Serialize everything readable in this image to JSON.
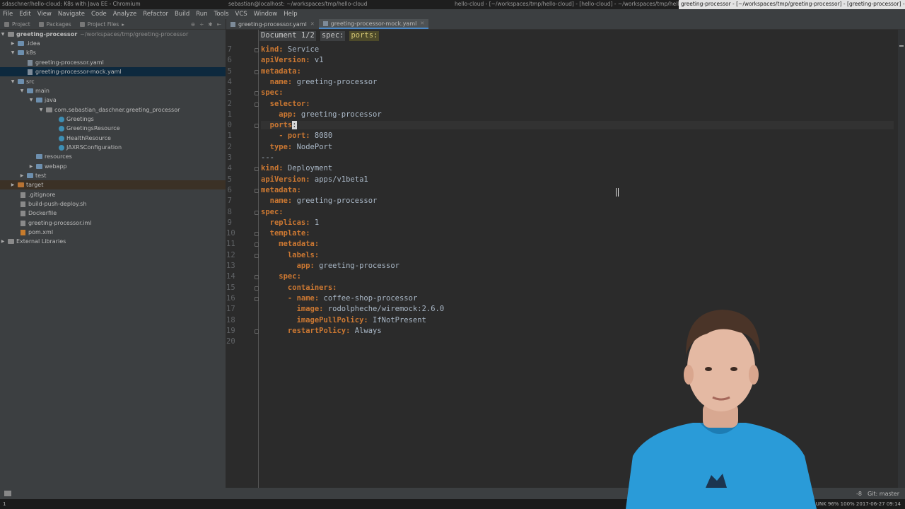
{
  "os_titles": [
    "sdaschner/hello-cloud: K8s with Java EE - Chromium",
    "sebastian@localhost: ~/workspaces/tmp/hello-cloud",
    "hello-cloud - [~/workspaces/tmp/hello-cloud] - [hello-cloud] - ~/workspaces/tmp/hello-cloud/...",
    "greeting-processor - [~/workspaces/tmp/greeting-processor] - [greeting-processor] - ~/worksp..."
  ],
  "menu": [
    "File",
    "Edit",
    "View",
    "Navigate",
    "Code",
    "Analyze",
    "Refactor",
    "Build",
    "Run",
    "Tools",
    "VCS",
    "Window",
    "Help"
  ],
  "project_toolbar": {
    "tabs": [
      "Project",
      "Packages",
      "Project Files"
    ],
    "icons": [
      "target-icon",
      "split-icon",
      "gear-icon",
      "collapse-icon"
    ]
  },
  "tree": {
    "root": "greeting-processor",
    "root_path": "~/workspaces/tmp/greeting-processor",
    "items": [
      {
        "label": ".idea"
      },
      {
        "label": "k8s"
      },
      {
        "label": "greeting-processor.yaml"
      },
      {
        "label": "greeting-processor-mock.yaml"
      },
      {
        "label": "src"
      },
      {
        "label": "main"
      },
      {
        "label": "java"
      },
      {
        "label": "com.sebastian_daschner.greeting_processor"
      },
      {
        "label": "Greetings"
      },
      {
        "label": "GreetingsResource"
      },
      {
        "label": "HealthResource"
      },
      {
        "label": "JAXRSConfiguration"
      },
      {
        "label": "resources"
      },
      {
        "label": "webapp"
      },
      {
        "label": "test"
      },
      {
        "label": "target"
      },
      {
        "label": ".gitignore"
      },
      {
        "label": "build-push-deploy.sh"
      },
      {
        "label": "Dockerfile"
      },
      {
        "label": "greeting-processor.iml"
      },
      {
        "label": "pom.xml"
      },
      {
        "label": "External Libraries"
      }
    ]
  },
  "editor_tabs": [
    {
      "label": "greeting-processor.yaml",
      "active": false
    },
    {
      "label": "greeting-processor-mock.yaml",
      "active": true
    }
  ],
  "breadcrumbs": [
    "Document 1/2",
    "spec:",
    "ports:"
  ],
  "line_numbers": [
    "7",
    "6",
    "5",
    "4",
    "3",
    "2",
    "1",
    "0",
    "1",
    "2",
    "3",
    "4",
    "5",
    "6",
    "7",
    "8",
    "9",
    "10",
    "11",
    "12",
    "13",
    "14",
    "15",
    "16",
    "17",
    "18",
    "19",
    "20"
  ],
  "code_lines": [
    {
      "key": "kind:",
      "val": " Service"
    },
    {
      "key": "apiVersion:",
      "val": " v1"
    },
    {
      "key": "metadata:",
      "val": ""
    },
    {
      "key": "  name:",
      "val": " greeting-processor"
    },
    {
      "key": "spec:",
      "val": ""
    },
    {
      "key": "  selector:",
      "val": ""
    },
    {
      "key": "    app:",
      "val": " greeting-processor"
    },
    {
      "key": "  ports",
      "val": ":"
    },
    {
      "key": "    - port:",
      "val": " 8080"
    },
    {
      "key": "  type:",
      "val": " NodePort"
    },
    {
      "key": "",
      "val": "---"
    },
    {
      "key": "kind:",
      "val": " Deployment"
    },
    {
      "key": "apiVersion:",
      "val": " apps/v1beta1"
    },
    {
      "key": "metadata:",
      "val": ""
    },
    {
      "key": "  name:",
      "val": " greeting-processor"
    },
    {
      "key": "spec:",
      "val": ""
    },
    {
      "key": "  replicas:",
      "val": " 1"
    },
    {
      "key": "  template:",
      "val": ""
    },
    {
      "key": "    metadata:",
      "val": ""
    },
    {
      "key": "      labels:",
      "val": ""
    },
    {
      "key": "        app:",
      "val": " greeting-processor"
    },
    {
      "key": "    spec:",
      "val": ""
    },
    {
      "key": "      containers:",
      "val": ""
    },
    {
      "key": "      - name:",
      "val": " coffee-shop-processor"
    },
    {
      "key": "        image:",
      "val": " rodolpheche/wiremock:2.6.0"
    },
    {
      "key": "        imagePullPolicy:",
      "val": " IfNotPresent"
    },
    {
      "key": "      restartPolicy:",
      "val": " Always"
    },
    {
      "key": "",
      "val": ""
    }
  ],
  "status": {
    "encoding": "-8",
    "git": "Git: master"
  },
  "os_tray": {
    "left": "1",
    "right": "UNK 96%   100%  2017-06-27 09:14"
  },
  "colors": {
    "keyword": "#cc7832",
    "text": "#a9b7c6",
    "background": "#2b2b2b",
    "panel": "#3c3f41",
    "selection": "#0d293e"
  }
}
